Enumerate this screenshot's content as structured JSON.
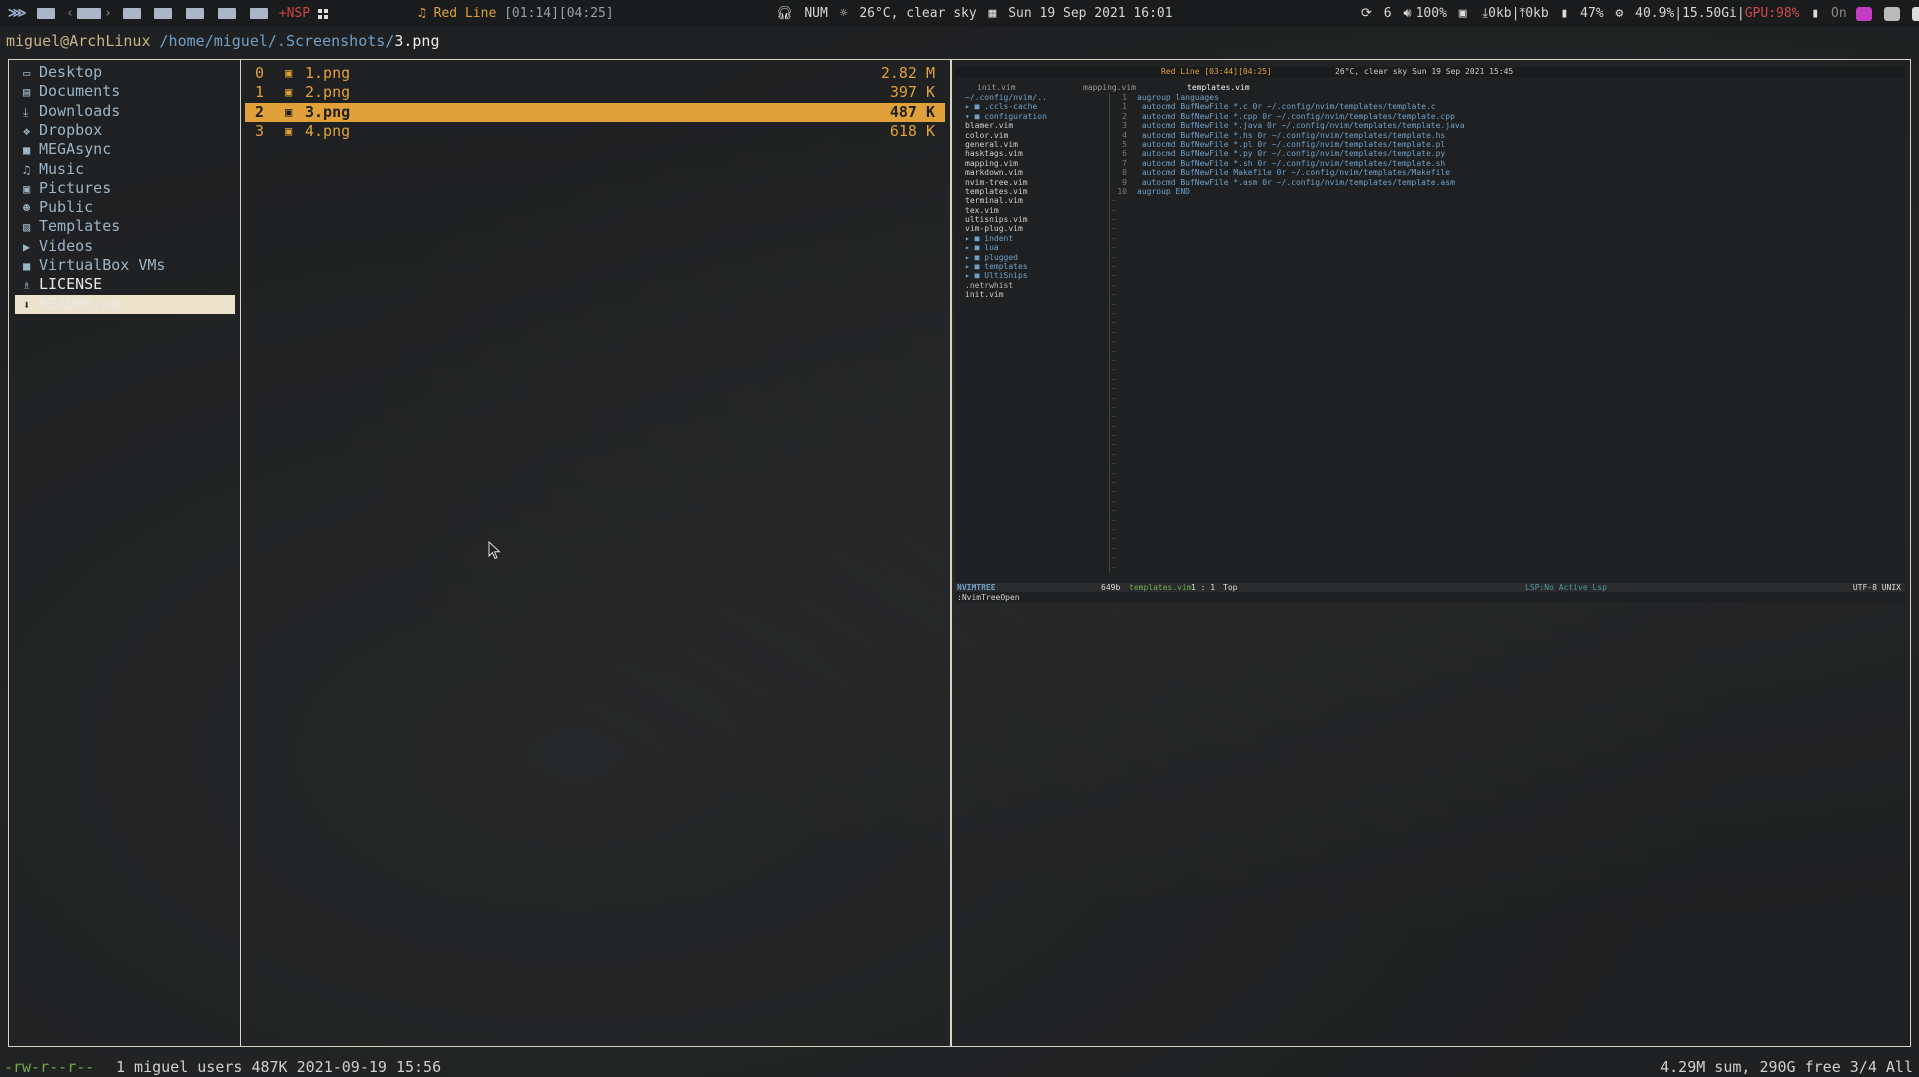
{
  "topbar": {
    "nsp_label": "+NSP",
    "music_title": "Red Line",
    "music_time": "[01:14][04:25]",
    "num_lock": "NUM",
    "weather": "26°C, clear sky",
    "datetime": "Sun 19 Sep 2021 16:01",
    "updates": "6",
    "volume": "100%",
    "net_down": "0kb",
    "net_up": "0kb",
    "battery": "47%",
    "cpu_mem": "40.9%|15.50Gi",
    "gpu": "GPU:98%",
    "power": "On"
  },
  "path": {
    "user_host": "miguel@ArchLinux",
    "directory": "/home/miguel/.Screenshots/",
    "file": "3.png"
  },
  "left_pane": {
    "items": [
      {
        "label": "Desktop",
        "icon": "desktop-icon",
        "glyph": "▭"
      },
      {
        "label": "Documents",
        "icon": "document-icon",
        "glyph": "▤"
      },
      {
        "label": "Downloads",
        "icon": "download-icon",
        "glyph": "⤓"
      },
      {
        "label": "Dropbox",
        "icon": "dropbox-icon",
        "glyph": "❖"
      },
      {
        "label": "MEGAsync",
        "icon": "folder-icon",
        "glyph": "■"
      },
      {
        "label": "Music",
        "icon": "headphones-icon",
        "glyph": "♫"
      },
      {
        "label": "Pictures",
        "icon": "picture-icon",
        "glyph": "▣"
      },
      {
        "label": "Public",
        "icon": "users-icon",
        "glyph": "☻"
      },
      {
        "label": "Templates",
        "icon": "template-icon",
        "glyph": "▧"
      },
      {
        "label": "Videos",
        "icon": "video-icon",
        "glyph": "▶"
      },
      {
        "label": "VirtualBox VMs",
        "icon": "folder-icon",
        "glyph": "■"
      },
      {
        "label": "LICENSE",
        "icon": "license-icon",
        "glyph": "♗"
      },
      {
        "label": "README.md",
        "icon": "markdown-icon",
        "glyph": "⬇"
      }
    ],
    "selected_index": 12
  },
  "mid_pane": {
    "files": [
      {
        "index": "0",
        "name": "1.png",
        "size": "2.82 M"
      },
      {
        "index": "1",
        "name": "2.png",
        "size": "397 K"
      },
      {
        "index": "2",
        "name": "3.png",
        "size": "487 K"
      },
      {
        "index": "3",
        "name": "4.png",
        "size": "618 K"
      }
    ],
    "selected_index": 2
  },
  "preview": {
    "top_music": "Red Line [03:44][04:25]",
    "top_datetime": "26°C, clear sky  Sun 19 Sep 2021 15:45",
    "tabs": [
      "init.vim",
      "mapping.vim",
      "templates.vim"
    ],
    "tree_root": "~/.config/nvim/..",
    "tree": [
      {
        "text": "▸ ■ .ccls-cache",
        "type": "folder"
      },
      {
        "text": "▾ ■ configuration",
        "type": "folder"
      },
      {
        "text": "    blamer.vim",
        "type": "vim"
      },
      {
        "text": "    color.vim",
        "type": "vim"
      },
      {
        "text": "    general.vim",
        "type": "vim"
      },
      {
        "text": "    hasktags.vim",
        "type": "vim"
      },
      {
        "text": "    mapping.vim",
        "type": "vim"
      },
      {
        "text": "    markdown.vim",
        "type": "vim"
      },
      {
        "text": "    nvim-tree.vim",
        "type": "vim"
      },
      {
        "text": "    templates.vim",
        "type": "vim"
      },
      {
        "text": "    terminal.vim",
        "type": "vim"
      },
      {
        "text": "    tex.vim",
        "type": "vim"
      },
      {
        "text": "    ultisnips.vim",
        "type": "vim"
      },
      {
        "text": "    vim-plug.vim",
        "type": "vim"
      },
      {
        "text": "▸ ■ indent",
        "type": "folder"
      },
      {
        "text": "▸ ■ lua",
        "type": "folder"
      },
      {
        "text": "▸ ■ plugged",
        "type": "folder"
      },
      {
        "text": "▸ ■ templates",
        "type": "folder"
      },
      {
        "text": "▸ ■ UltiSnips",
        "type": "folder"
      },
      {
        "text": "  .netrwhist",
        "type": "plain"
      },
      {
        "text": "  init.vim",
        "type": "vim"
      }
    ],
    "code": [
      {
        "ln": "1",
        "text": "augroup languages"
      },
      {
        "ln": "1",
        "text": "    autocmd BufNewFile *.c 0r ~/.config/nvim/templates/template.c"
      },
      {
        "ln": "2",
        "text": "    autocmd BufNewFile *.cpp 0r ~/.config/nvim/templates/template.cpp"
      },
      {
        "ln": "3",
        "text": "    autocmd BufNewFile *.java 0r ~/.config/nvim/templates/template.java"
      },
      {
        "ln": "4",
        "text": "    autocmd BufNewFile *.hs 0r ~/.config/nvim/templates/template.hs"
      },
      {
        "ln": "5",
        "text": "    autocmd BufNewFile *.pl 0r ~/.config/nvim/templates/template.pl"
      },
      {
        "ln": "6",
        "text": "    autocmd BufNewFile *.py 0r ~/.config/nvim/templates/template.py"
      },
      {
        "ln": "7",
        "text": "    autocmd BufNewFile *.sh 0r ~/.config/nvim/templates/template.sh"
      },
      {
        "ln": "8",
        "text": "    autocmd BufNewFile Makefile 0r ~/.config/nvim/templates/Makefile"
      },
      {
        "ln": "9",
        "text": "    autocmd BufNewFile *.asm 0r ~/.config/nvim/templates/template.asm"
      },
      {
        "ln": "10",
        "text": "augroup END"
      }
    ],
    "status_mode": "NVIMTREE",
    "status_size": "649b",
    "status_file": "templates.vim",
    "status_pos": "1 : 1",
    "status_top": "Top",
    "status_lsp": "LSP:No Active Lsp",
    "status_enc": "UTF-8 UNIX",
    "cmdline": ":NvimTreeOpen"
  },
  "bottom": {
    "permissions": "-rw-r--r--",
    "info": "1 miguel users 487K 2021-09-19 15:56",
    "summary": "4.29M sum, 290G free  3/4  All"
  },
  "colors": {
    "accent_orange": "#e0a13a",
    "dir_blue": "#9ab4c8",
    "border": "#d8d2c4",
    "perm_green": "#6faa4a"
  }
}
